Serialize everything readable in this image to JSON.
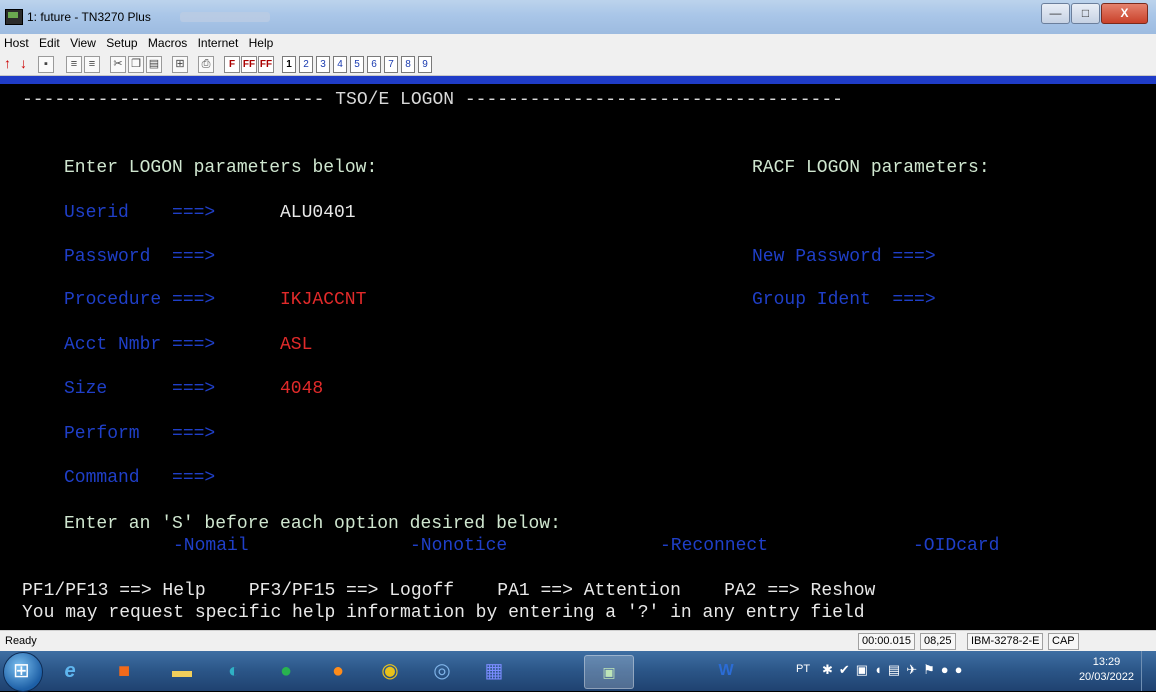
{
  "window": {
    "title": "1: future - TN3270 Plus",
    "controls": {
      "minimize": "—",
      "maximize": "□",
      "close": "X"
    }
  },
  "menu": [
    "Host",
    "Edit",
    "View",
    "Setup",
    "Macros",
    "Internet",
    "Help"
  ],
  "toolbar": {
    "sessions": [
      "1",
      "2",
      "3",
      "4",
      "5",
      "6",
      "7",
      "8",
      "9"
    ],
    "function_keys": [
      "F",
      "FF",
      "FF"
    ]
  },
  "terminal": {
    "header": "---------------------------- TSO/E LOGON -----------------------------------",
    "left_heading": "Enter LOGON parameters below:",
    "right_heading": "RACF LOGON parameters:",
    "fields": {
      "userid": {
        "label": "Userid    ===>",
        "value": "ALU0401"
      },
      "password": {
        "label": "Password  ===>",
        "value": ""
      },
      "procedure": {
        "label": "Procedure ===>",
        "value": "IKJACCNT"
      },
      "acct": {
        "label": "Acct Nmbr ===>",
        "value": "ASL"
      },
      "size": {
        "label": "Size      ===>",
        "value": "4048"
      },
      "perform": {
        "label": "Perform   ===>",
        "value": ""
      },
      "command": {
        "label": "Command   ===>",
        "value": ""
      },
      "new_password": {
        "label": "New Password ===>",
        "value": ""
      },
      "group_ident": {
        "label": "Group Ident  ===>",
        "value": ""
      }
    },
    "options_prompt": "Enter an 'S' before each option desired below:",
    "options": [
      "-Nomail",
      "-Nonotice",
      "-Reconnect",
      "-OIDcard"
    ],
    "pf_line": "PF1/PF13 ==> Help    PF3/PF15 ==> Logoff    PA1 ==> Attention    PA2 ==> Reshow",
    "help_line": "You may request specific help information by entering a '?' in any entry field"
  },
  "status": {
    "state": "Ready",
    "timer": "00:00.015",
    "cursor": "08,25",
    "terminal_type": "IBM-3278-2-E",
    "caps": "CAP"
  },
  "taskbar": {
    "language": "PT",
    "time": "13:29",
    "date": "20/03/2022"
  },
  "colors": {
    "field_label": "#1f3fc8",
    "entered_value": "#e12a2a",
    "protected_text": "#e8e8e8",
    "accent_strip": "#1f3cc7"
  }
}
